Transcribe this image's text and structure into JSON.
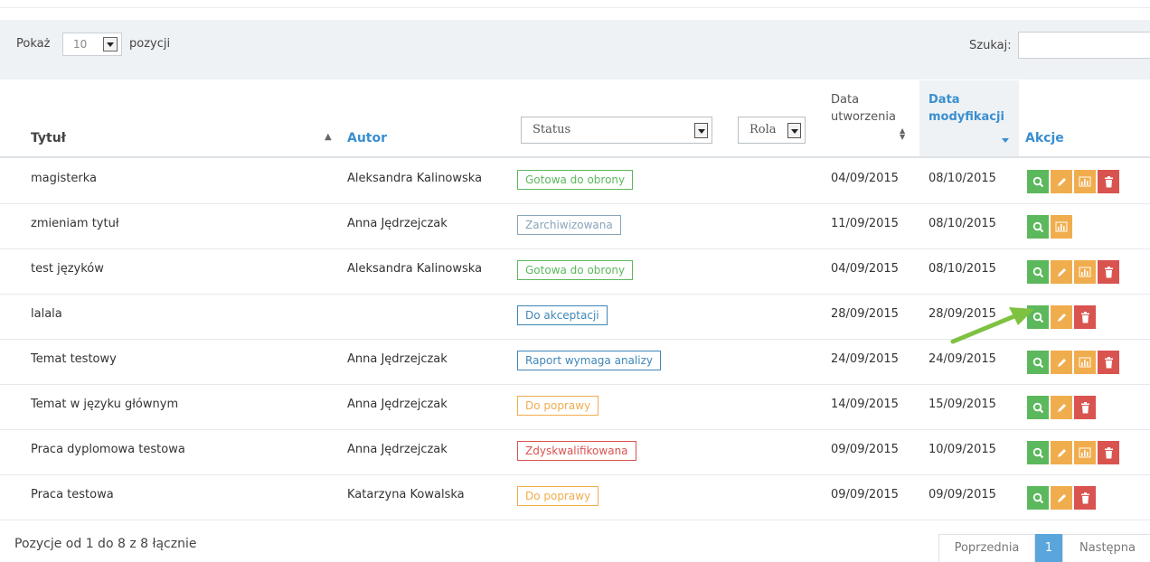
{
  "toolbar": {
    "show_label": "Pokaż",
    "page_length": "10",
    "show_suffix": "pozycji",
    "search_label": "Szukaj:",
    "search_value": ""
  },
  "columns": {
    "title": "Tytuł",
    "author": "Autor",
    "status_filter": "Status",
    "role_filter": "Rola",
    "created_line1": "Data",
    "created_line2": "utworzenia",
    "modified_line1": "Data",
    "modified_line2": "modyfikacji",
    "actions": "Akcje"
  },
  "status_colors": {
    "green": "#5cb85c",
    "gray": "#8aa4b8",
    "blue": "#3f86b8",
    "orange": "#f0ad4e",
    "red": "#d9534f"
  },
  "rows": [
    {
      "title": "magisterka",
      "author": "Aleksandra Kalinowska",
      "status": "Gotowa do obrony",
      "status_color": "green",
      "created": "04/09/2015",
      "modified": "08/10/2015",
      "actions": [
        "view",
        "edit",
        "report",
        "delete"
      ]
    },
    {
      "title": "zmieniam tytuł",
      "author": "Anna Jędrzejczak",
      "status": "Zarchiwizowana",
      "status_color": "gray",
      "created": "11/09/2015",
      "modified": "08/10/2015",
      "actions": [
        "view",
        "report"
      ]
    },
    {
      "title": "test języków",
      "author": "Aleksandra Kalinowska",
      "status": "Gotowa do obrony",
      "status_color": "green",
      "created": "04/09/2015",
      "modified": "08/10/2015",
      "actions": [
        "view",
        "edit",
        "report",
        "delete"
      ]
    },
    {
      "title": "lalala",
      "author": "",
      "status": "Do akceptacji",
      "status_color": "blue",
      "created": "28/09/2015",
      "modified": "28/09/2015",
      "actions": [
        "view",
        "edit",
        "delete"
      ]
    },
    {
      "title": "Temat testowy",
      "author": "Anna Jędrzejczak",
      "status": "Raport wymaga analizy",
      "status_color": "blue",
      "created": "24/09/2015",
      "modified": "24/09/2015",
      "actions": [
        "view",
        "edit",
        "report",
        "delete"
      ]
    },
    {
      "title": "Temat w języku głównym",
      "author": "Anna Jędrzejczak",
      "status": "Do poprawy",
      "status_color": "orange",
      "created": "14/09/2015",
      "modified": "15/09/2015",
      "actions": [
        "view",
        "edit",
        "delete"
      ]
    },
    {
      "title": "Praca dyplomowa testowa",
      "author": "Anna Jędrzejczak",
      "status": "Zdyskwalifikowana",
      "status_color": "red",
      "created": "09/09/2015",
      "modified": "10/09/2015",
      "actions": [
        "view",
        "edit",
        "report",
        "delete"
      ]
    },
    {
      "title": "Praca testowa",
      "author": "Katarzyna Kowalska",
      "status": "Do poprawy",
      "status_color": "orange",
      "created": "09/09/2015",
      "modified": "09/09/2015",
      "actions": [
        "view",
        "edit",
        "delete"
      ]
    }
  ],
  "footer": {
    "info": "Pozycje od 1 do 8 z 8 łącznie",
    "prev": "Poprzednia",
    "page": "1",
    "next": "Następna"
  },
  "action_icons": {
    "view": "search-icon",
    "edit": "pencil-icon",
    "report": "bar-chart-icon",
    "delete": "trash-icon"
  }
}
